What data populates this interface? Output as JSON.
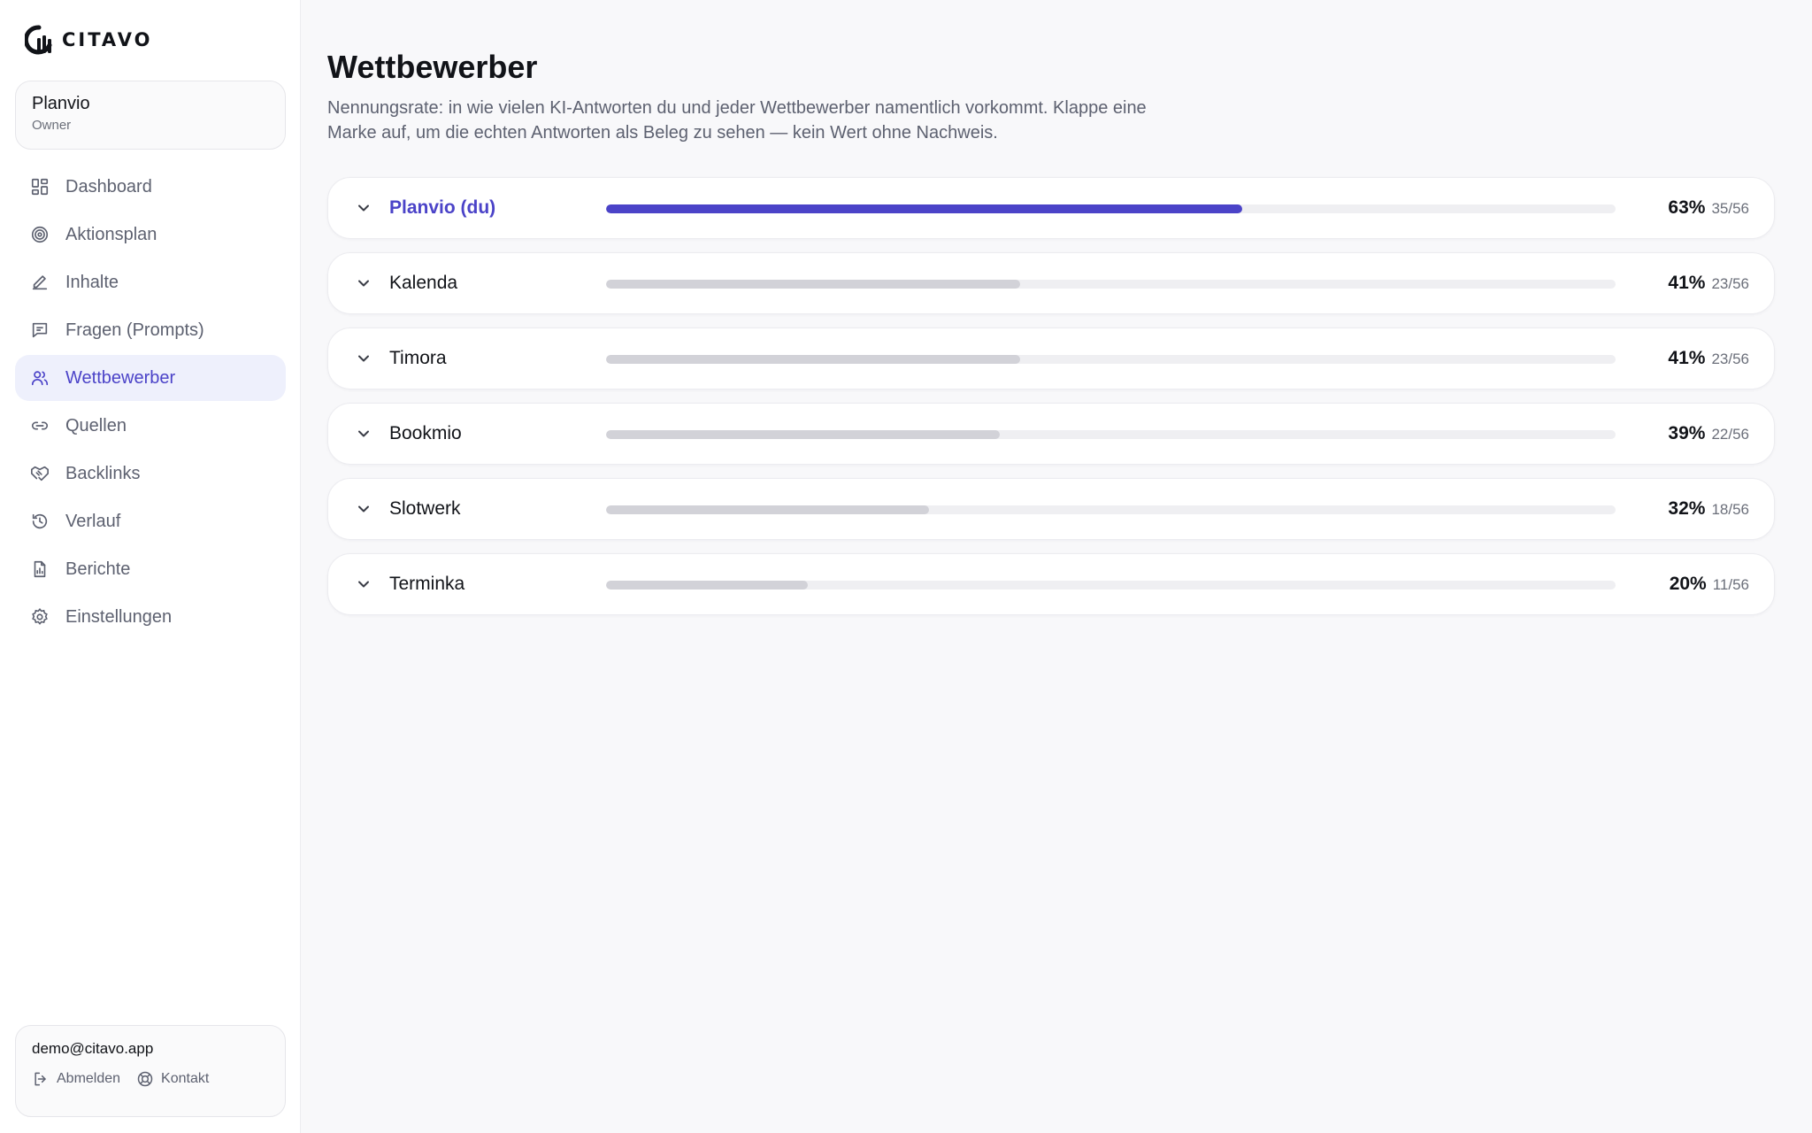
{
  "app": {
    "logo_text": "CITAVO"
  },
  "workspace": {
    "name": "Planvio",
    "role": "Owner"
  },
  "nav": [
    {
      "label": "Dashboard",
      "icon": "dashboard-icon"
    },
    {
      "label": "Aktionsplan",
      "icon": "target-icon"
    },
    {
      "label": "Inhalte",
      "icon": "pen-icon"
    },
    {
      "label": "Fragen (Prompts)",
      "icon": "message-icon"
    },
    {
      "label": "Wettbewerber",
      "icon": "users-icon",
      "active": true
    },
    {
      "label": "Quellen",
      "icon": "link-icon"
    },
    {
      "label": "Backlinks",
      "icon": "handshake-icon"
    },
    {
      "label": "Verlauf",
      "icon": "history-icon"
    },
    {
      "label": "Berichte",
      "icon": "report-icon"
    },
    {
      "label": "Einstellungen",
      "icon": "gear-icon"
    }
  ],
  "user": {
    "email": "demo@citavo.app",
    "logout_label": "Abmelden",
    "contact_label": "Kontakt"
  },
  "page": {
    "title": "Wettbewerber",
    "description": "Nennungsrate: in wie vielen KI-Antworten du und jeder Wettbewerber namentlich vorkommt. Klappe eine Marke auf, um die echten Antworten als Beleg zu sehen — kein Wert ohne Nachweis."
  },
  "colors": {
    "accent": "#4b43c8",
    "bar_neutral": "#d2d2d8",
    "track": "#efeff2"
  },
  "competitors": [
    {
      "name": "Planvio (du)",
      "percent": "63%",
      "ratio": "35/56",
      "share": 0.63,
      "self": true
    },
    {
      "name": "Kalenda",
      "percent": "41%",
      "ratio": "23/56",
      "share": 0.41
    },
    {
      "name": "Timora",
      "percent": "41%",
      "ratio": "23/56",
      "share": 0.41
    },
    {
      "name": "Bookmio",
      "percent": "39%",
      "ratio": "22/56",
      "share": 0.39
    },
    {
      "name": "Slotwerk",
      "percent": "32%",
      "ratio": "18/56",
      "share": 0.32
    },
    {
      "name": "Terminka",
      "percent": "20%",
      "ratio": "11/56",
      "share": 0.2
    }
  ]
}
